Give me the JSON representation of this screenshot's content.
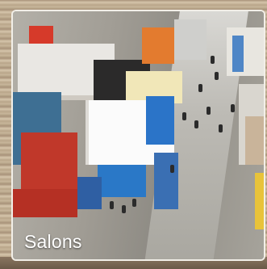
{
  "card": {
    "title": "Salons"
  },
  "colors": {
    "frame_wood": "#b7a285",
    "photo_border": "#f2efe8",
    "label_text": "#ffffff"
  }
}
